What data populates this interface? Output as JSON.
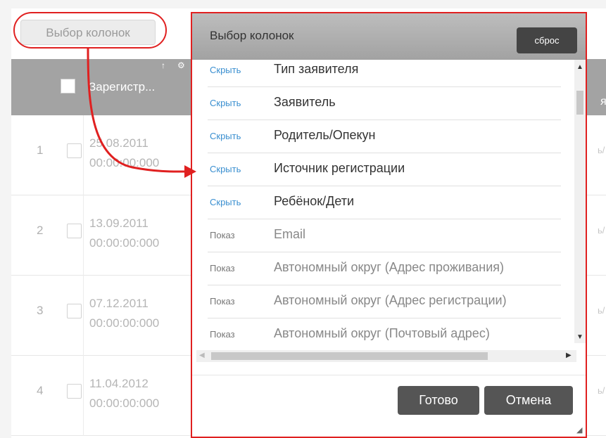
{
  "column_picker_button": {
    "label": "Выбор колонок"
  },
  "table": {
    "header": {
      "column_label": "Зарегистр...",
      "right_fragment": "я"
    },
    "rows": [
      {
        "num": "1",
        "date": "25.08.2011",
        "time": "00:00:00:000",
        "tail": "ь/"
      },
      {
        "num": "2",
        "date": "13.09.2011",
        "time": "00:00:00:000",
        "tail": "ь/"
      },
      {
        "num": "3",
        "date": "07.12.2011",
        "time": "00:00:00:000",
        "tail": "ь/"
      },
      {
        "num": "4",
        "date": "11.04.2012",
        "time": "00:00:00:000",
        "tail": "ь/"
      }
    ]
  },
  "dialog": {
    "title": "Выбор колонок",
    "reset_label": "сброс",
    "items": [
      {
        "action": "Скрыть",
        "name": "Тип заявителя"
      },
      {
        "action": "Скрыть",
        "name": "Заявитель"
      },
      {
        "action": "Скрыть",
        "name": "Родитель/Опекун"
      },
      {
        "action": "Скрыть",
        "name": "Источник регистрации"
      },
      {
        "action": "Скрыть",
        "name": "Ребёнок/Дети"
      },
      {
        "action": "Показ",
        "name": "Email"
      },
      {
        "action": "Показ",
        "name": "Автономный округ (Адрес проживания)"
      },
      {
        "action": "Показ",
        "name": "Автономный округ (Адрес регистрации)"
      },
      {
        "action": "Показ",
        "name": "Автономный округ (Почтовый адрес)"
      }
    ],
    "done_label": "Готово",
    "cancel_label": "Отмена"
  },
  "colors": {
    "annotation_red": "#e02020",
    "hide_link": "#3a8fd0",
    "header_gray": "#a3a3a3",
    "button_dark": "#555555"
  }
}
